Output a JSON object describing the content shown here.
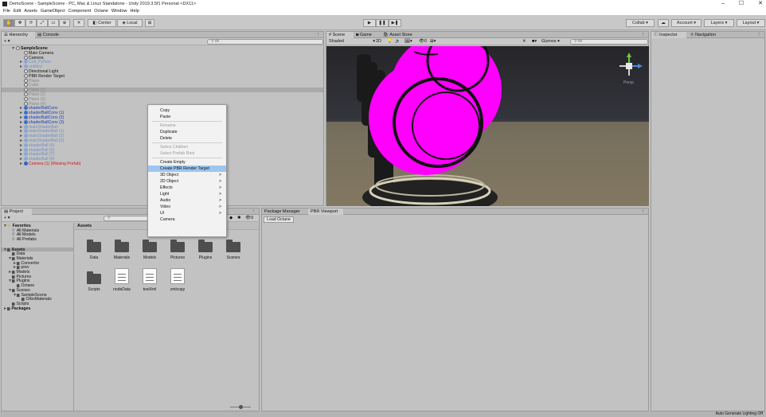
{
  "titlebar": {
    "title": "DemoScene - SampleScene - PC, Mac & Linux Standalone - Unity 2019.3.5f1 Personal <DX11>",
    "minimize": "–",
    "maximize": "☐",
    "close": "✕"
  },
  "menu": [
    "File",
    "Edit",
    "Assets",
    "GameObject",
    "Component",
    "Octane",
    "Window",
    "Help"
  ],
  "toolbar": {
    "center": "Center",
    "local": "Local",
    "collab": "Collab ▾",
    "account": "Account ▾",
    "layers": "Layers ▾",
    "layout": "Layout ▾"
  },
  "hierarchy": {
    "tabs": [
      "Hierarchy",
      "Console"
    ],
    "add": "+ ▾",
    "search_placeholder": "All",
    "rows": [
      {
        "label": "SampleScene",
        "indent": 1,
        "kind": "scene",
        "arrow": "▼"
      },
      {
        "label": "Main Camera",
        "indent": 2,
        "kind": "go"
      },
      {
        "label": "Camera",
        "indent": 2,
        "kind": "go"
      },
      {
        "label": "Colt_Python",
        "indent": 2,
        "kind": "pfg",
        "arrow": "►"
      },
      {
        "label": "untitled",
        "indent": 2,
        "kind": "pfg",
        "arrow": "►"
      },
      {
        "label": "Directional Light",
        "indent": 2,
        "kind": "go"
      },
      {
        "label": "PBR Render Target",
        "indent": 2,
        "kind": "go"
      },
      {
        "label": "Plane",
        "indent": 2,
        "kind": "gray"
      },
      {
        "label": "Cube",
        "indent": 2,
        "kind": "gray"
      },
      {
        "label": "Plane (1)",
        "indent": 2,
        "kind": "gray",
        "sel": true
      },
      {
        "label": "Plane (2)",
        "indent": 2,
        "kind": "gray"
      },
      {
        "label": "Plane (3)",
        "indent": 2,
        "kind": "gray"
      },
      {
        "label": "Plane (4)",
        "indent": 2,
        "kind": "gray"
      },
      {
        "label": "shaderBallConv",
        "indent": 2,
        "kind": "pf",
        "arrow": "►"
      },
      {
        "label": "shaderBallConv (1)",
        "indent": 2,
        "kind": "pf",
        "arrow": "►"
      },
      {
        "label": "shaderBallConv (2)",
        "indent": 2,
        "kind": "pf",
        "arrow": "►"
      },
      {
        "label": "shaderBallConv (3)",
        "indent": 2,
        "kind": "pf",
        "arrow": "►"
      },
      {
        "label": "mainShaderBall",
        "indent": 2,
        "kind": "pfg",
        "arrow": "►"
      },
      {
        "label": "mainShaderBall (1)",
        "indent": 2,
        "kind": "pfg",
        "arrow": "►"
      },
      {
        "label": "mainShaderBall (2)",
        "indent": 2,
        "kind": "pfg",
        "arrow": "►"
      },
      {
        "label": "mainShaderBall (3)",
        "indent": 2,
        "kind": "pfg",
        "arrow": "►"
      },
      {
        "label": "shaderBall (4)",
        "indent": 2,
        "kind": "pfg",
        "arrow": "►"
      },
      {
        "label": "shaderBall (5)",
        "indent": 2,
        "kind": "pfg",
        "arrow": "►"
      },
      {
        "label": "shaderBall (7)",
        "indent": 2,
        "kind": "pfg",
        "arrow": "►"
      },
      {
        "label": "shaderBall (6)",
        "indent": 2,
        "kind": "pfg",
        "arrow": "►"
      },
      {
        "label": "Camera (1) (Missing Prefab)",
        "indent": 2,
        "kind": "red",
        "arrow": "►"
      }
    ]
  },
  "context_menu": [
    {
      "label": "Copy"
    },
    {
      "label": "Paste"
    },
    {
      "sep": true
    },
    {
      "label": "Rename",
      "disabled": true
    },
    {
      "label": "Duplicate"
    },
    {
      "label": "Delete"
    },
    {
      "sep": true
    },
    {
      "label": "Select Children",
      "disabled": true
    },
    {
      "label": "Select Prefab Root",
      "disabled": true
    },
    {
      "sep": true
    },
    {
      "label": "Create Empty"
    },
    {
      "label": "Create PBR Render Target",
      "highlighted": true
    },
    {
      "label": "3D Object",
      "sub": true
    },
    {
      "label": "2D Object",
      "sub": true
    },
    {
      "label": "Effects",
      "sub": true
    },
    {
      "label": "Light",
      "sub": true
    },
    {
      "label": "Audio",
      "sub": true
    },
    {
      "label": "Video",
      "sub": true
    },
    {
      "label": "UI",
      "sub": true
    },
    {
      "label": "Camera"
    }
  ],
  "scene": {
    "tabs": [
      "Scene",
      "Game",
      "Asset Store"
    ],
    "shading": "Shaded",
    "mode_2d": "2D",
    "gizmos": "Gizmos",
    "search_placeholder": "All",
    "persp": "Persp",
    "colors": {
      "sky": "#2b2b30",
      "ground": "#8c8268",
      "magenta": "#ff00ff"
    }
  },
  "inspector": {
    "tabs": [
      "Inspector",
      "Navigation"
    ]
  },
  "project": {
    "tabs": [
      "Project"
    ],
    "add": "+ ▾",
    "count": "9",
    "breadcrumb": "Assets",
    "tree": [
      {
        "label": "Favorites",
        "indent": 0,
        "arrow": "▼",
        "bold": true
      },
      {
        "label": "All Materials",
        "indent": 1
      },
      {
        "label": "All Models",
        "indent": 1
      },
      {
        "label": "All Prefabs",
        "indent": 1
      },
      {
        "label": "",
        "indent": 0
      },
      {
        "label": "Assets",
        "indent": 0,
        "arrow": "▼",
        "bold": true,
        "sel": true
      },
      {
        "label": "Data",
        "indent": 1
      },
      {
        "label": "Materials",
        "indent": 1,
        "arrow": "▼"
      },
      {
        "label": "Convertor",
        "indent": 2,
        "arrow": "►"
      },
      {
        "label": "prev",
        "indent": 2,
        "arrow": "►"
      },
      {
        "label": "Models",
        "indent": 1,
        "arrow": "►"
      },
      {
        "label": "Pictures",
        "indent": 1
      },
      {
        "label": "Plugins",
        "indent": 1,
        "arrow": "▼"
      },
      {
        "label": "Octane",
        "indent": 2
      },
      {
        "label": "Scenes",
        "indent": 1,
        "arrow": "▼"
      },
      {
        "label": "SampleScene",
        "indent": 2,
        "arrow": "▼"
      },
      {
        "label": "OrbxMaterials",
        "indent": 3
      },
      {
        "label": "Scripts",
        "indent": 1
      },
      {
        "label": "Packages",
        "indent": 0,
        "arrow": "►",
        "bold": true
      }
    ],
    "assets": [
      {
        "label": "Data",
        "type": "folder"
      },
      {
        "label": "Materials",
        "type": "folder"
      },
      {
        "label": "Models",
        "type": "folder"
      },
      {
        "label": "Pictures",
        "type": "folder"
      },
      {
        "label": "Plugins",
        "type": "folder"
      },
      {
        "label": "Scenes",
        "type": "folder"
      },
      {
        "label": "Scripts",
        "type": "folder"
      },
      {
        "label": "nodeData",
        "type": "file"
      },
      {
        "label": "testXml",
        "type": "file"
      },
      {
        "label": "xmlcopy",
        "type": "file"
      }
    ]
  },
  "pbr": {
    "tabs": [
      "Package Manager",
      "PBR Viewport"
    ],
    "load_button": "Load Octane"
  },
  "status": {
    "right": "Auto Generate Lighting Off"
  }
}
